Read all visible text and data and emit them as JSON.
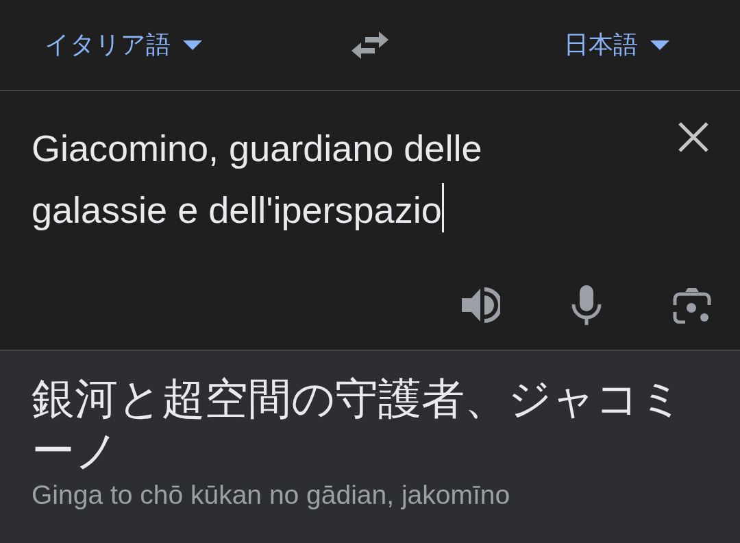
{
  "language_bar": {
    "source_language": "イタリア語",
    "target_language": "日本語"
  },
  "source": {
    "text": "Giacomino, guardiano delle galassie e dell'iperspazio",
    "focused": true
  },
  "translation": {
    "text": "銀河と超空間の守護者、ジャコミーノ",
    "romanization": "Ginga to chō kūkan no gādian, jakomīno"
  }
}
